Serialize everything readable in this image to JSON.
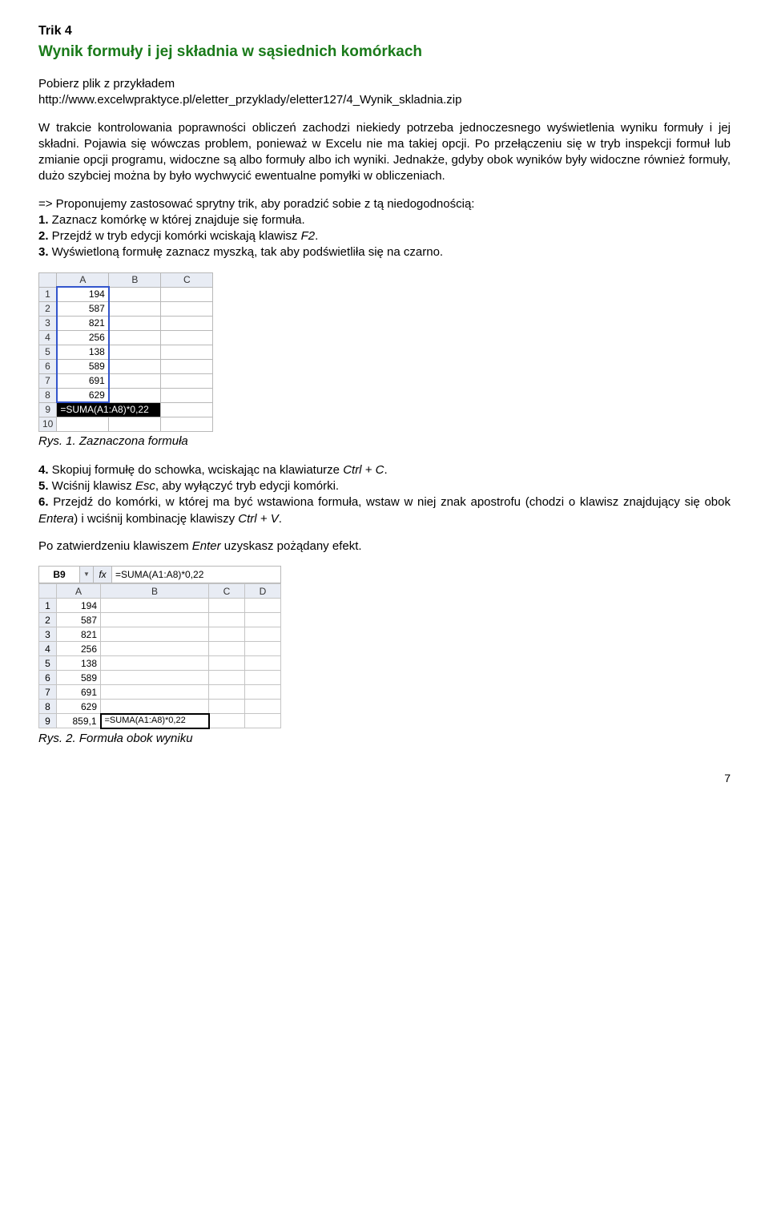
{
  "trik_label": "Trik 4",
  "title": "Wynik formuły i jej składnia w sąsiednich komórkach",
  "intro_line1": "Pobierz plik z przykładem",
  "intro_url": "http://www.excelwpraktyce.pl/eletter_przyklady/eletter127/4_Wynik_skladnia.zip",
  "para1": "W trakcie kontrolowania poprawności obliczeń zachodzi niekiedy potrzeba jednoczesnego wyświetlenia wyniku formuły i jej składni. Pojawia się wówczas problem, ponieważ w Excelu nie ma takiej opcji. Po przełączeniu się w tryb inspekcji formuł lub zmianie opcji programu, widoczne są albo formuły albo ich wyniki. Jednakże, gdyby obok wyników były widoczne również formuły, dużo szybciej można by było wychwycić ewentualne pomyłki w obliczeniach.",
  "para2_lead": "=> Proponujemy zastosować sprytny trik, aby poradzić sobie z tą niedogodnością:",
  "steps_a": [
    {
      "num": "1.",
      "text": " Zaznacz komórkę w której znajduje się formuła."
    },
    {
      "num": "2.",
      "text": " Przejdź w tryb edycji komórki wciskają klawisz ",
      "tail_italic": "F2",
      "tail_end": "."
    },
    {
      "num": "3.",
      "text": " Wyświetloną formułę zaznacz myszką, tak aby podświetliła się na czarno."
    }
  ],
  "sheet1": {
    "cols": [
      "A",
      "B",
      "C"
    ],
    "rows": [
      "1",
      "2",
      "3",
      "4",
      "5",
      "6",
      "7",
      "8",
      "9",
      "10"
    ],
    "values": [
      "194",
      "587",
      "821",
      "256",
      "138",
      "589",
      "691",
      "629"
    ],
    "formula": "=SUMA(A1:A8)*0,22"
  },
  "caption1": "Rys. 1. Zaznaczona formuła",
  "steps_b": {
    "s4_num": "4.",
    "s4_text": " Skopiuj formułę do schowka, wciskając na klawiaturze ",
    "s4_it": "Ctrl + C",
    "s4_end": ".",
    "s5_num": "5.",
    "s5_text": " Wciśnij klawisz ",
    "s5_it": "Esc",
    "s5_end": ", aby wyłączyć tryb edycji komórki.",
    "s6_num": "6.",
    "s6_text": " Przejdź do komórki, w której ma być wstawiona formuła, wstaw w niej znak apostrofu (chodzi o klawisz znajdujący się obok ",
    "s6_it": "Entera",
    "s6_mid": ") i wciśnij kombinację klawiszy ",
    "s6_it2": "Ctrl + V",
    "s6_end": "."
  },
  "para_after": "Po zatwierdzeniu klawiszem ",
  "para_after_it": "Enter",
  "para_after_end": " uzyskasz pożądany efekt.",
  "sheet2": {
    "namebox": "B9",
    "fx": "fx",
    "formula_bar": "=SUMA(A1:A8)*0,22",
    "cols": [
      "A",
      "B",
      "C",
      "D"
    ],
    "rows": [
      "1",
      "2",
      "3",
      "4",
      "5",
      "6",
      "7",
      "8",
      "9"
    ],
    "values": [
      "194",
      "587",
      "821",
      "256",
      "138",
      "589",
      "691",
      "629",
      "859,1"
    ],
    "cell_b9": "=SUMA(A1:A8)*0,22"
  },
  "caption2": "Rys. 2. Formuła obok wyniku",
  "page": "7"
}
